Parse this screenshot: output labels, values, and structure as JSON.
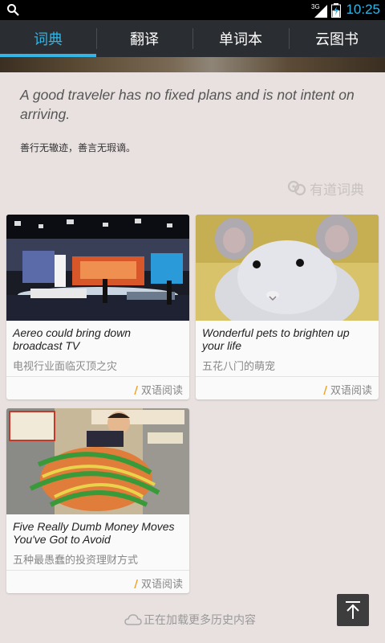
{
  "status": {
    "time": "10:25",
    "network": "3G"
  },
  "tabs": [
    {
      "label": "词典",
      "active": true
    },
    {
      "label": "翻译",
      "active": false
    },
    {
      "label": "单词本",
      "active": false
    },
    {
      "label": "云图书",
      "active": false
    }
  ],
  "daily": {
    "quote_en": "A good traveler has no fixed plans and is not intent on arriving.",
    "quote_cn": "善行无辙迹，善言无瑕谪。",
    "brand": "有道词典"
  },
  "cards": [
    {
      "title_en": "Aereo could bring down broadcast TV",
      "title_cn": "电视行业面临灭顶之灾",
      "action": "双语阅读",
      "image": "tv-studio-image"
    },
    {
      "title_en": "Wonderful pets to brighten up your life",
      "title_cn": "五花八门的萌宠",
      "action": "双语阅读",
      "image": "chinchilla-image"
    },
    {
      "title_en": "Five Really Dumb Money Moves You've Got to Avoid",
      "title_cn": "五种最愚蠢的投资理财方式",
      "action": "双语阅读",
      "image": "money-comic-image"
    }
  ],
  "footer": {
    "loading_text": "正在加载更多历史内容"
  },
  "colors": {
    "accent": "#33b5e5",
    "tabbar": "#2a2d31",
    "background": "#e8e1e0"
  }
}
